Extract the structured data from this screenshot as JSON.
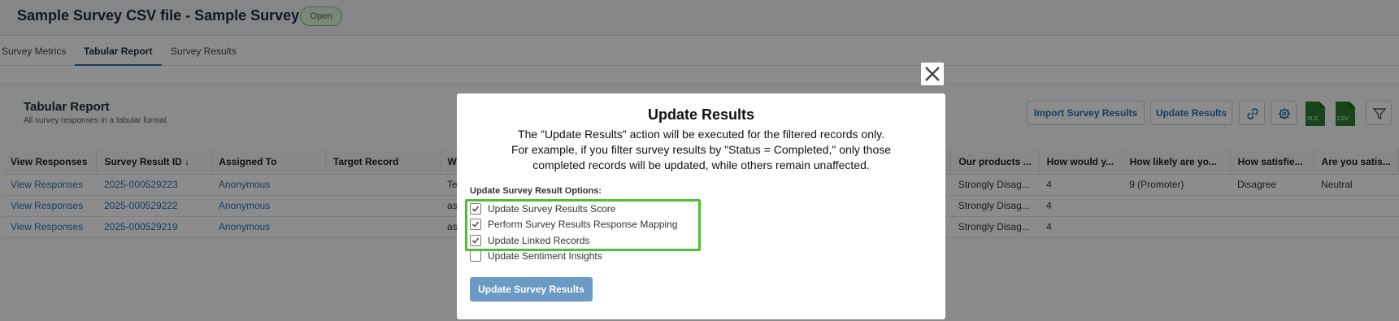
{
  "app": {
    "title": "Sample Survey CSV file - Sample Survey",
    "status": "Open"
  },
  "tabs": [
    {
      "label": "Survey Metrics",
      "active": false
    },
    {
      "label": "Tabular Report",
      "active": true
    },
    {
      "label": "Survey Results",
      "active": false
    }
  ],
  "report": {
    "title": "Tabular Report",
    "subtitle": "All survey responses in a tabular format.",
    "import_button": "Import Survey Results",
    "update_button": "Update Results",
    "icons": [
      "link-icon",
      "gear-icon",
      "xls-file-icon",
      "csv-file-icon",
      "filter-icon"
    ],
    "xls_label": "XLS",
    "csv_label": "CSV"
  },
  "table": {
    "columns": [
      "View Responses",
      "Survey Result ID ↓",
      "Assigned To",
      "Target Record",
      "W",
      "",
      "Our products ...",
      "How would y...",
      "How likely are yo...",
      "How satisfie...",
      "Are you satis..."
    ],
    "rows": [
      [
        "View Responses",
        "2025-000529223",
        "Anonymous",
        "",
        "Te",
        "",
        "Strongly Disag...",
        "4",
        "9 (Promoter)",
        "Disagree",
        "Neutral"
      ],
      [
        "View Responses",
        "2025-000529222",
        "Anonymous",
        "",
        "as",
        "",
        "Strongly Disag...",
        "4",
        "",
        "",
        ""
      ],
      [
        "View Responses",
        "2025-000529219",
        "Anonymous",
        "",
        "as",
        "",
        "Strongly Disag...",
        "4",
        "",
        "",
        ""
      ]
    ]
  },
  "modal": {
    "title": "Update Results",
    "body_lines": [
      "The \"Update Results\" action will be executed for the filtered records only.",
      "For example, if you filter survey results by \"Status = Completed,\" only those",
      "completed records will be updated, while others remain unaffected."
    ],
    "options_label": "Update Survey Result Options:",
    "options": [
      {
        "label": "Update Survey Results Score",
        "checked": true
      },
      {
        "label": "Perform Survey Results Response Mapping",
        "checked": true
      },
      {
        "label": "Update Linked Records",
        "checked": true
      },
      {
        "label": "Update Sentiment Insights",
        "checked": false
      }
    ],
    "submit_label": "Update Survey Results",
    "highlight_color": "#4cc233"
  },
  "colors": {
    "accent": "#2f6fa8",
    "primary_button": "#6b9ac4",
    "status_green": "#2e7d32"
  }
}
